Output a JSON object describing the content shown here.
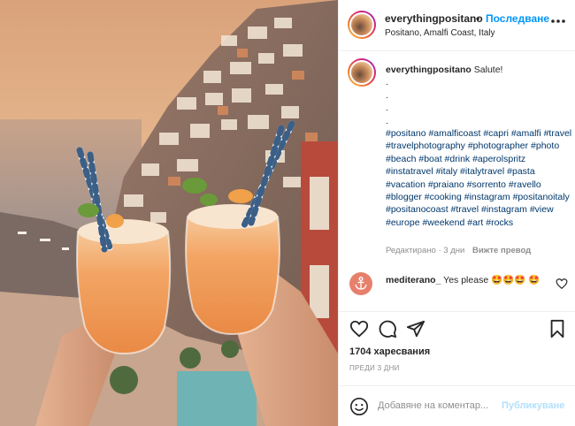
{
  "post": {
    "username": "everythingpositano",
    "separator": "•",
    "follow_label": "Последване",
    "location": "Positano, Amalfi Coast, Italy"
  },
  "caption": {
    "username": "everythingpositano",
    "text": "Salute!",
    "dots": [
      ".",
      ".",
      ".",
      "."
    ],
    "hashtags": "#positano #amalficoast #capri #amalfi #travel #travelphotography #photographer #photo #beach #boat #drink #aperolspritz #instatravel #italy #italytravel #pasta #vacation #praiano #sorrento #ravello #blogger #cooking #instagram #positanoitaly #positanocoast #travel #instagram #view #europe #weekend #art #rocks",
    "edited": "Редактирано · 3 дни",
    "translate": "Вижте превод"
  },
  "comment": {
    "username": "mediterano_",
    "text": "Yes please 🤩🤩🤩 🤩"
  },
  "likes": "1704 харесвания",
  "time_ago": "ПРЕДИ 3 ДНИ",
  "add_comment": {
    "placeholder": "Добавяне на коментар...",
    "publish": "Публикуване"
  },
  "colors": {
    "accent": "#0095f6",
    "hashtag": "#00376b",
    "muted": "#8e8e8e",
    "publish_disabled": "#b2dffc"
  },
  "icons": [
    "more-icon",
    "heart-icon",
    "comment-icon",
    "share-icon",
    "save-icon",
    "emoji-icon"
  ]
}
